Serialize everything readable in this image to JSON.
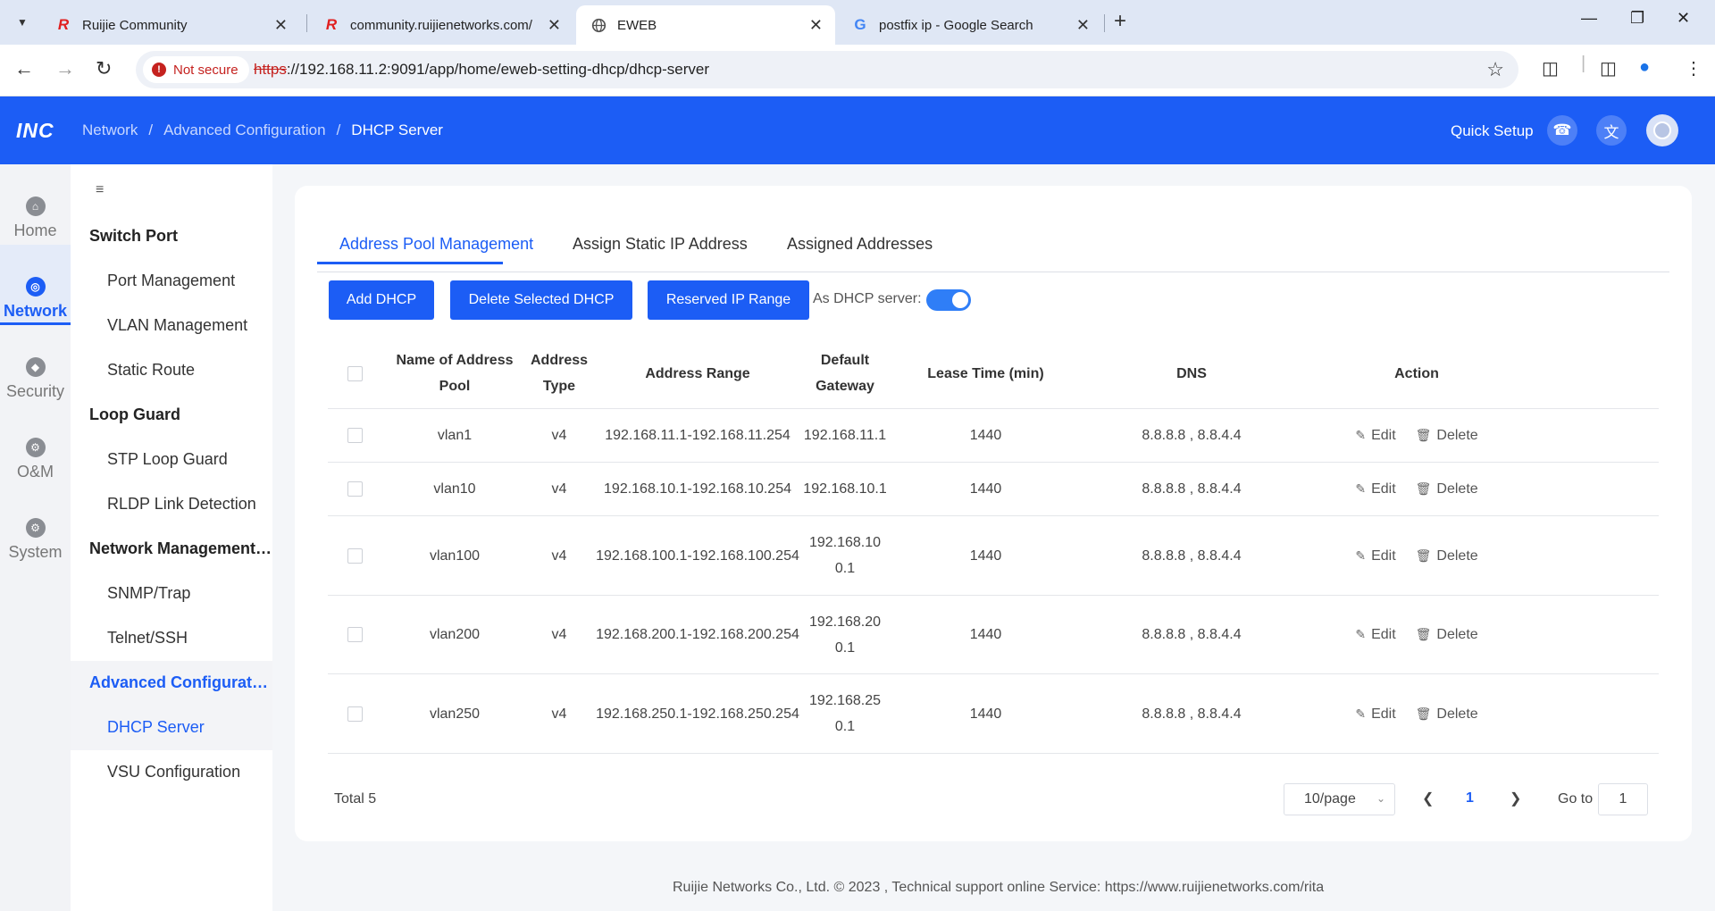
{
  "browser": {
    "tabs": [
      {
        "title": "Ruijie Community",
        "favicon": "R",
        "favicon_color": "#e02020"
      },
      {
        "title": "community.ruijienetworks.com/",
        "favicon": "R",
        "favicon_color": "#e02020"
      },
      {
        "title": "EWEB",
        "favicon": "globe-icon",
        "favicon_color": "#555555"
      },
      {
        "title": "postfix ip - Google Search",
        "favicon": "G",
        "favicon_color": "#4285f4"
      }
    ],
    "security_label": "Not secure",
    "url_scheme": "https",
    "url_rest": "://192.168.11.2:9091/app/home/eweb-setting-dhcp/dhcp-server"
  },
  "header": {
    "logo": "INC",
    "breadcrumb": [
      "Network",
      "Advanced Configuration",
      "DHCP Server"
    ],
    "breadcrumb_sep": "/",
    "quick_setup": "Quick Setup",
    "accent": "#1c5df5"
  },
  "rail": {
    "items": [
      {
        "label": "Home",
        "icon": "home-icon"
      },
      {
        "label": "Network",
        "icon": "globe-icon"
      },
      {
        "label": "Security",
        "icon": "shield-icon"
      },
      {
        "label": "O&M",
        "icon": "wrench-icon"
      },
      {
        "label": "System",
        "icon": "gear-icon"
      }
    ],
    "active": "Network"
  },
  "submenu": {
    "groups": [
      {
        "label": "Switch Port",
        "items": [
          "Port Management",
          "VLAN Management",
          "Static Route"
        ]
      },
      {
        "label": "Loop Guard",
        "items": [
          "STP Loop Guard",
          "RLDP Link Detection"
        ]
      },
      {
        "label": "Network Management ...",
        "items": [
          "SNMP/Trap",
          "Telnet/SSH"
        ]
      },
      {
        "label": "Advanced Configuration",
        "items": [
          "DHCP Server",
          "VSU Configuration"
        ]
      }
    ],
    "active_item": "DHCP Server"
  },
  "content": {
    "tabs": [
      "Address Pool Management",
      "Assign Static IP Address",
      "Assigned Addresses"
    ],
    "active_tab": "Address Pool Management",
    "buttons": {
      "add": "Add DHCP",
      "delete_selected": "Delete Selected DHCP",
      "reserved": "Reserved IP Range"
    },
    "dhcp_server_label": "As DHCP server:",
    "dhcp_server_enabled": true,
    "table": {
      "headers": {
        "name": "Name of Address Pool",
        "type": "Address Type",
        "range": "Address Range",
        "gateway": "Default Gateway",
        "lease": "Lease Time (min)",
        "dns": "DNS",
        "action": "Action"
      },
      "rows": [
        {
          "name": "vlan1",
          "type": "v4",
          "range": "192.168.11.1-192.168.11.254",
          "gateway": "192.168.11.1",
          "lease": "1440",
          "dns": "8.8.8.8 , 8.8.4.4"
        },
        {
          "name": "vlan10",
          "type": "v4",
          "range": "192.168.10.1-192.168.10.254",
          "gateway": "192.168.10.1",
          "lease": "1440",
          "dns": "8.8.8.8 , 8.8.4.4"
        },
        {
          "name": "vlan100",
          "type": "v4",
          "range": "192.168.100.1-192.168.100.254",
          "gateway": "192.168.100.1",
          "lease": "1440",
          "dns": "8.8.8.8 , 8.8.4.4"
        },
        {
          "name": "vlan200",
          "type": "v4",
          "range": "192.168.200.1-192.168.200.254",
          "gateway": "192.168.200.1",
          "lease": "1440",
          "dns": "8.8.8.8 , 8.8.4.4"
        },
        {
          "name": "vlan250",
          "type": "v4",
          "range": "192.168.250.1-192.168.250.254",
          "gateway": "192.168.250.1",
          "lease": "1440",
          "dns": "8.8.8.8 , 8.8.4.4"
        }
      ],
      "edit_label": "Edit",
      "delete_label": "Delete"
    },
    "pagination": {
      "total": "Total 5",
      "page_size": "10/page",
      "current_page": "1",
      "goto_label": "Go to",
      "goto_value": "1"
    }
  },
  "footer": "Ruijie Networks Co., Ltd. © 2023 ,  Technical support online Service: https://www.ruijienetworks.com/rita"
}
